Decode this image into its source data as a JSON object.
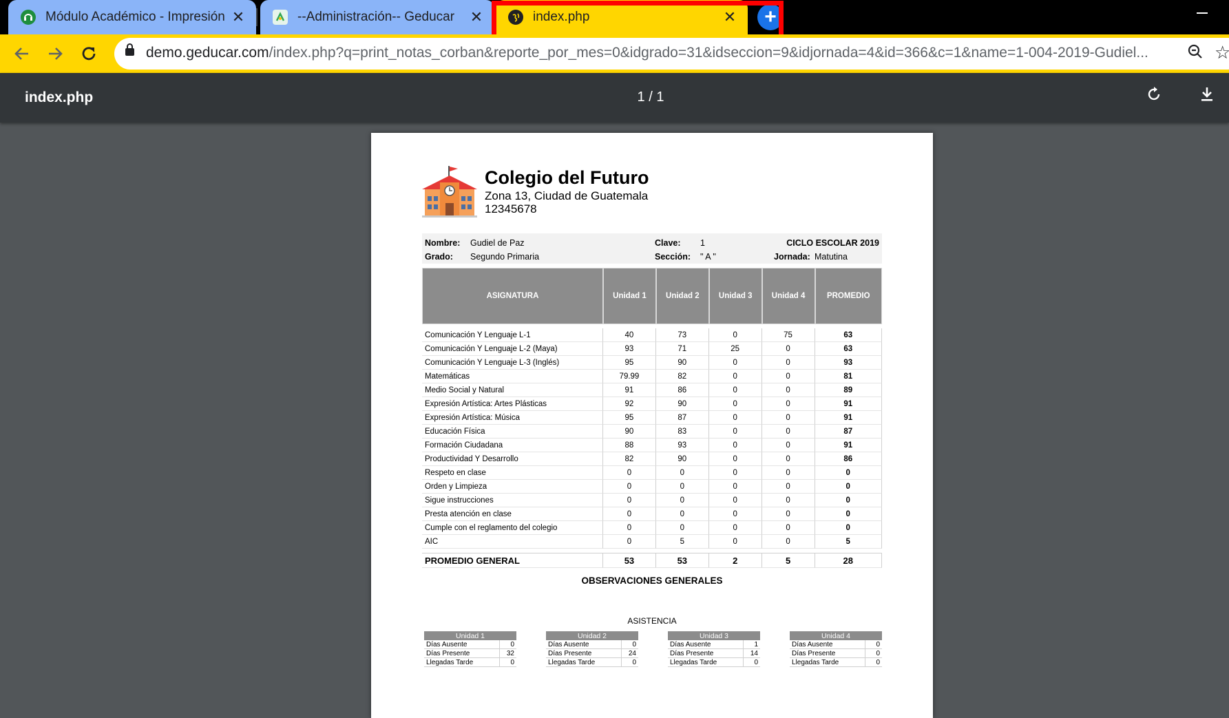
{
  "browser": {
    "tabs": [
      {
        "title": "Módulo Académico - Impresión de",
        "favicon": "headset-icon",
        "favicon_color": "#1e8e3e"
      },
      {
        "title": "--Administración-- Geducar",
        "favicon": "geducar-logo-icon",
        "favicon_color": "#34a853"
      },
      {
        "title": "index.php",
        "favicon": "globe-icon",
        "active": true
      }
    ],
    "url_host": "demo.geducar.com",
    "url_path": "/index.php?q=print_notas_corban&reporte_por_mes=0&idgrado=31&idseccion=9&idjornada=4&id=366&c=1&name=1-004-2019-Gudiel...",
    "accent_color": "#ffd600",
    "highlight_color": "#ff0000"
  },
  "pdf_viewer": {
    "title": "index.php",
    "page_indicator": "1 / 1"
  },
  "report": {
    "school_name": "Colegio del Futuro",
    "school_address": "Zona 13, Ciudad de Guatemala",
    "school_phone": "12345678",
    "labels": {
      "nombre": "Nombre:",
      "grado": "Grado:",
      "clave": "Clave:",
      "seccion": "Sección:",
      "jornada": "Jornada:",
      "ciclo": "CICLO ESCOLAR 2019"
    },
    "student": {
      "nombre": "Gudiel de Paz",
      "grado": "Segundo Primaria",
      "clave": "1",
      "seccion": "\" A \"",
      "jornada": "Matutina"
    },
    "table_headers": [
      "ASIGNATURA",
      "Unidad 1",
      "Unidad 2",
      "Unidad 3",
      "Unidad 4",
      "PROMEDIO"
    ],
    "rows": [
      [
        "Comunicación Y Lenguaje L-1",
        "40",
        "73",
        "0",
        "75",
        "63"
      ],
      [
        "Comunicación Y Lenguaje L-2 (Maya)",
        "93",
        "71",
        "25",
        "0",
        "63"
      ],
      [
        "Comunicación Y Lenguaje L-3 (Inglés)",
        "95",
        "90",
        "0",
        "0",
        "93"
      ],
      [
        "Matemáticas",
        "79.99",
        "82",
        "0",
        "0",
        "81"
      ],
      [
        "Medio Social y Natural",
        "91",
        "86",
        "0",
        "0",
        "89"
      ],
      [
        "Expresión Artística: Artes Plásticas",
        "92",
        "90",
        "0",
        "0",
        "91"
      ],
      [
        "Expresión Artística: Música",
        "95",
        "87",
        "0",
        "0",
        "91"
      ],
      [
        "Educación Física",
        "90",
        "83",
        "0",
        "0",
        "87"
      ],
      [
        "Formación Ciudadana",
        "88",
        "93",
        "0",
        "0",
        "91"
      ],
      [
        "Productividad Y Desarrollo",
        "82",
        "90",
        "0",
        "0",
        "86"
      ],
      [
        "Respeto en clase",
        "0",
        "0",
        "0",
        "0",
        "0"
      ],
      [
        "Orden y Limpieza",
        "0",
        "0",
        "0",
        "0",
        "0"
      ],
      [
        "Sigue instrucciones",
        "0",
        "0",
        "0",
        "0",
        "0"
      ],
      [
        "Presta atención en clase",
        "0",
        "0",
        "0",
        "0",
        "0"
      ],
      [
        "Cumple con el reglamento del colegio",
        "0",
        "0",
        "0",
        "0",
        "0"
      ],
      [
        "AIC",
        "0",
        "5",
        "0",
        "0",
        "5"
      ]
    ],
    "promedio_general": [
      "PROMEDIO GENERAL",
      "53",
      "53",
      "2",
      "5",
      "28"
    ],
    "observaciones_title": "OBSERVACIONES GENERALES",
    "asistencia_title": "ASISTENCIA",
    "attendance": [
      {
        "unit": "Unidad 1",
        "items": [
          [
            "Días Ausente",
            "0"
          ],
          [
            "Días Presente",
            "32"
          ],
          [
            "Llegadas Tarde",
            "0"
          ]
        ]
      },
      {
        "unit": "Unidad 2",
        "items": [
          [
            "Días Ausente",
            "0"
          ],
          [
            "Días Presente",
            "24"
          ],
          [
            "Llegadas Tarde",
            "0"
          ]
        ]
      },
      {
        "unit": "Unidad 3",
        "items": [
          [
            "Días Ausente",
            "1"
          ],
          [
            "Días Presente",
            "14"
          ],
          [
            "Llegadas Tarde",
            "0"
          ]
        ]
      },
      {
        "unit": "Unidad 4",
        "items": [
          [
            "Días Ausente",
            "0"
          ],
          [
            "Días Presente",
            "0"
          ],
          [
            "Llegadas Tarde",
            "0"
          ]
        ]
      }
    ]
  }
}
